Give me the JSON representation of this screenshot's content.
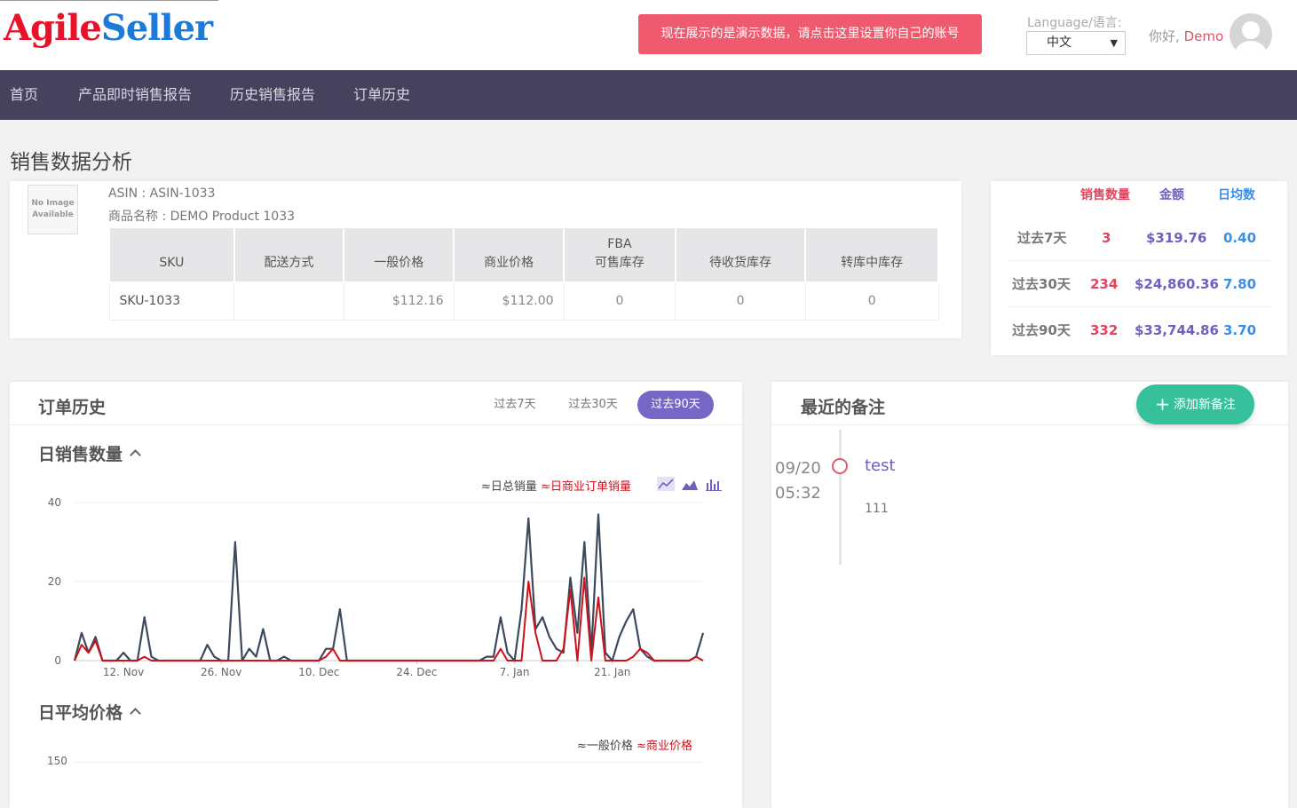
{
  "header": {
    "logo_part1": "Agile",
    "logo_part2": "Seller",
    "demo_banner": "现在展示的是演示数据，请点击这里设置你自己的账号",
    "language_label": "Language/语言:",
    "language_value": "中文",
    "greeting": "你好,",
    "username": "Demo"
  },
  "nav": {
    "items": [
      "首页",
      "产品即时销售报告",
      "历史销售报告",
      "订单历史"
    ]
  },
  "page": {
    "title": "销售数据分析"
  },
  "product": {
    "no_image_line1": "No Image",
    "no_image_line2": "Available",
    "asin": "ASIN : ASIN-1033",
    "name": "商品名称 : DEMO Product 1033",
    "table": {
      "headers": [
        "SKU",
        "配送方式",
        "一般价格",
        "商业价格",
        "FBA",
        "可售库存",
        "待收货库存",
        "转库中库存"
      ],
      "row": [
        "SKU-1033",
        "",
        "$112.16",
        "$112.00",
        "0",
        "0",
        "0"
      ]
    }
  },
  "stats": {
    "headers": [
      "销售数量",
      "金额",
      "日均数"
    ],
    "rows": [
      {
        "label": "过去7天",
        "qty": "3",
        "amount": "$319.76",
        "avg": "0.40"
      },
      {
        "label": "过去30天",
        "qty": "234",
        "amount": "$24,860.36",
        "avg": "7.80"
      },
      {
        "label": "过去90天",
        "qty": "332",
        "amount": "$33,744.86",
        "avg": "3.70"
      }
    ],
    "colors": {
      "qty": "#e0475f",
      "amount": "#6f5fbf",
      "avg": "#3a8ee6"
    }
  },
  "orders": {
    "title": "订单历史",
    "ranges": [
      "过去7天",
      "过去30天",
      "过去90天"
    ],
    "active_range": "过去90天",
    "daily_qty_title": "日销售数量",
    "legend_total": "日总销量",
    "legend_business": "日商业订单销量",
    "avg_price_title": "日平均价格",
    "legend_normal_price": "一般价格",
    "legend_business_price": "商业价格",
    "price_axis_top": "150"
  },
  "chart_data": {
    "type": "line",
    "ylim": [
      0,
      40
    ],
    "yticks": [
      "0",
      "20",
      "40"
    ],
    "xtick_labels": [
      "12. Nov",
      "26. Nov",
      "10. Dec",
      "24. Dec",
      "7. Jan",
      "21. Jan"
    ],
    "xtick_index": [
      7,
      21,
      35,
      49,
      63,
      77
    ],
    "series": [
      {
        "name": "日总销量",
        "color": "#3d4a5c",
        "values": [
          0,
          7,
          2,
          6,
          0,
          0,
          0,
          2,
          0,
          0,
          11,
          1,
          0,
          0,
          0,
          0,
          0,
          0,
          0,
          4,
          1,
          0,
          0,
          30,
          0,
          3,
          1,
          8,
          0,
          0,
          1,
          0,
          0,
          0,
          0,
          0,
          3,
          3,
          13,
          0,
          0,
          0,
          0,
          0,
          0,
          0,
          0,
          0,
          0,
          0,
          0,
          0,
          0,
          0,
          0,
          0,
          0,
          0,
          0,
          1,
          1,
          11,
          2,
          0,
          13,
          36,
          8,
          11,
          6,
          3,
          2,
          21,
          7,
          30,
          2,
          37,
          2,
          0,
          6,
          10,
          13,
          3,
          1,
          0,
          0,
          0,
          0,
          0,
          0,
          1,
          7
        ]
      },
      {
        "name": "日商业订单销量",
        "color": "#d0101a",
        "values": [
          0,
          4,
          2,
          5,
          0,
          0,
          0,
          0,
          0,
          0,
          1,
          0,
          0,
          0,
          0,
          0,
          0,
          0,
          0,
          0,
          0,
          0,
          0,
          0,
          0,
          0,
          0,
          0,
          0,
          0,
          0,
          0,
          0,
          0,
          0,
          0,
          1,
          3,
          0,
          0,
          0,
          0,
          0,
          0,
          0,
          0,
          0,
          0,
          0,
          0,
          0,
          0,
          0,
          0,
          0,
          0,
          0,
          0,
          0,
          0,
          0,
          3,
          0,
          0,
          0,
          20,
          7,
          0,
          0,
          0,
          3,
          18,
          0,
          21,
          0,
          16,
          0,
          0,
          0,
          0,
          1,
          3,
          2,
          0,
          0,
          0,
          0,
          0,
          0,
          1,
          0
        ]
      }
    ]
  },
  "notes": {
    "title": "最近的备注",
    "add_button": "添加新备注",
    "entries": [
      {
        "date": "09/20",
        "time": "05:32",
        "title": "test",
        "body": "111"
      }
    ]
  }
}
